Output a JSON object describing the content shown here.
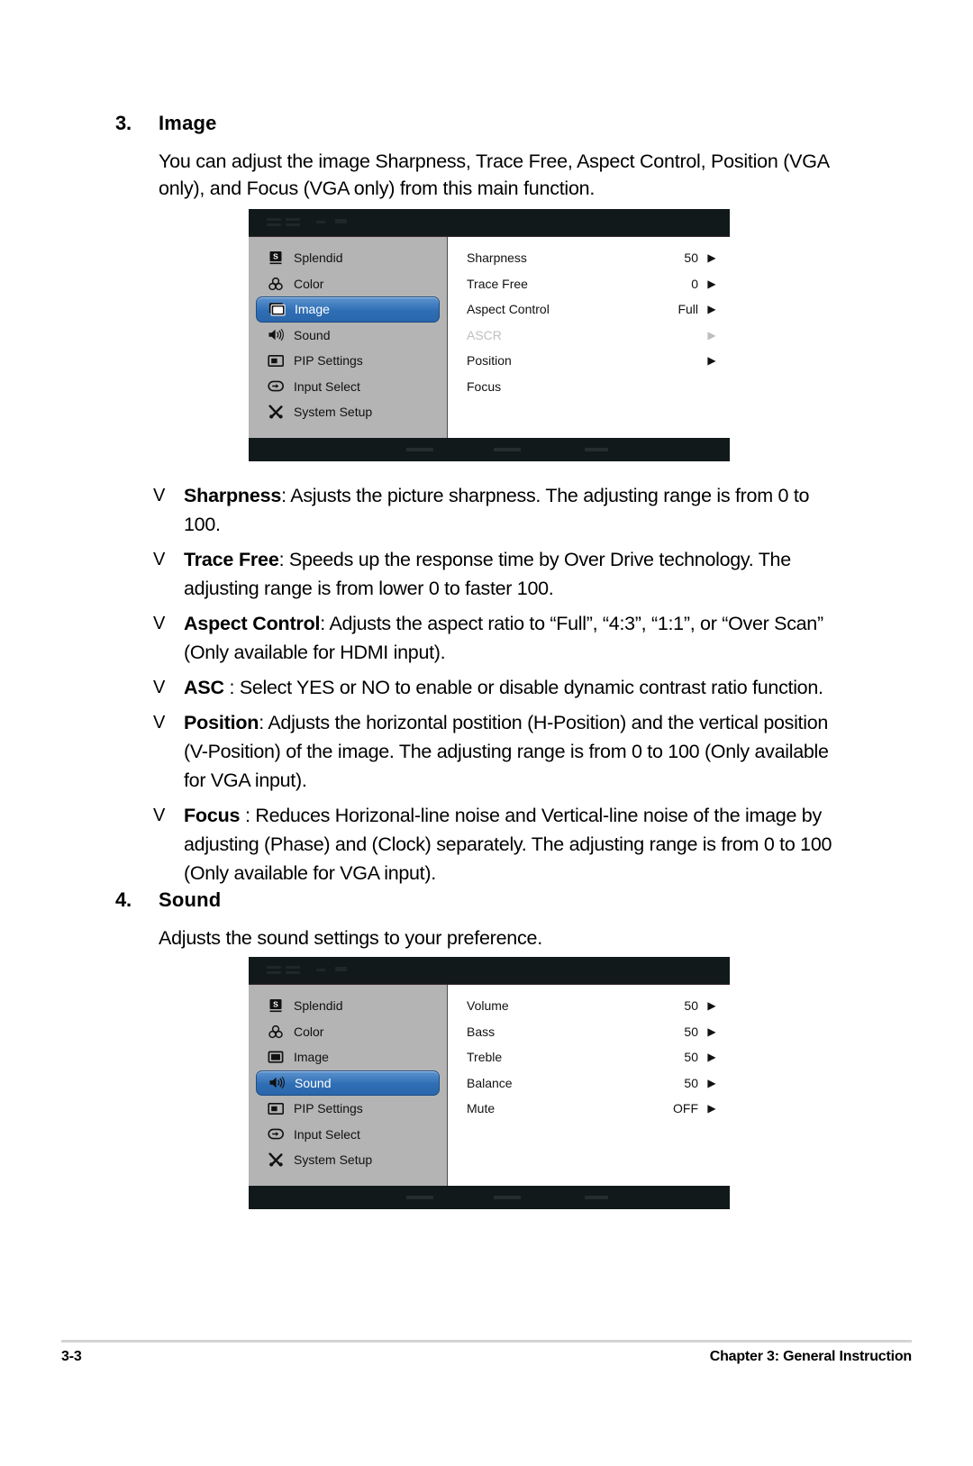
{
  "sections": [
    {
      "number": "3.",
      "title": "Image",
      "intro": "You can adjust the image Sharpness, Trace Free, Aspect Control, Position (VGA only), and Focus (VGA only) from this main function."
    },
    {
      "number": "4.",
      "title": "Sound",
      "intro": "Adjusts the sound settings to your preference."
    }
  ],
  "osd_image": {
    "menu_items": [
      {
        "label": "Splendid",
        "icon": "splendid-icon",
        "selected": false
      },
      {
        "label": "Color",
        "icon": "color-icon",
        "selected": false
      },
      {
        "label": "Image",
        "icon": "image-icon",
        "selected": true
      },
      {
        "label": "Sound",
        "icon": "sound-icon",
        "selected": false
      },
      {
        "label": "PIP Settings",
        "icon": "pip-settings-icon",
        "selected": false
      },
      {
        "label": "Input Select",
        "icon": "input-select-icon",
        "selected": false
      },
      {
        "label": "System Setup",
        "icon": "system-setup-icon",
        "selected": false
      }
    ],
    "options": [
      {
        "label": "Sharpness",
        "value": "50",
        "arrow": "normal",
        "disabled": false
      },
      {
        "label": "Trace Free",
        "value": "0",
        "arrow": "normal",
        "disabled": false
      },
      {
        "label": "Aspect Control",
        "value": "Full",
        "arrow": "normal",
        "disabled": false
      },
      {
        "label": "ASCR",
        "value": "",
        "arrow": "dim",
        "disabled": true
      },
      {
        "label": "Position",
        "value": "",
        "arrow": "normal",
        "disabled": false
      },
      {
        "label": "Focus",
        "value": "",
        "arrow": "none",
        "disabled": false
      }
    ]
  },
  "osd_sound": {
    "menu_items": [
      {
        "label": "Splendid",
        "icon": "splendid-icon",
        "selected": false
      },
      {
        "label": "Color",
        "icon": "color-icon",
        "selected": false
      },
      {
        "label": "Image",
        "icon": "image-icon",
        "selected": false
      },
      {
        "label": "Sound",
        "icon": "sound-icon",
        "selected": true
      },
      {
        "label": "PIP Settings",
        "icon": "pip-settings-icon",
        "selected": false
      },
      {
        "label": "Input Select",
        "icon": "input-select-icon",
        "selected": false
      },
      {
        "label": "System Setup",
        "icon": "system-setup-icon",
        "selected": false
      }
    ],
    "options": [
      {
        "label": "Volume",
        "value": "50",
        "arrow": "normal",
        "disabled": false
      },
      {
        "label": "Bass",
        "value": "50",
        "arrow": "normal",
        "disabled": false
      },
      {
        "label": "Treble",
        "value": "50",
        "arrow": "normal",
        "disabled": false
      },
      {
        "label": "Balance",
        "value": "50",
        "arrow": "normal",
        "disabled": false
      },
      {
        "label": "Mute",
        "value": "OFF",
        "arrow": "normal",
        "disabled": false
      }
    ]
  },
  "bullets": [
    {
      "mark": "V",
      "term": "Sharpness",
      "rest": ": Asjusts the picture sharpness. The adjusting range is from 0 to 100."
    },
    {
      "mark": "V",
      "term": "Trace Free",
      "rest": ": Speeds up the response time by Over Drive technology. The adjusting range is from lower 0 to faster 100."
    },
    {
      "mark": "V",
      "term": "Aspect Control",
      "rest": ": Adjusts the aspect ratio to “Full”, “4:3”, “1:1”, or “Over Scan” (Only available for HDMI input)."
    },
    {
      "mark": "V",
      "term": "ASC",
      "rest": " : Select YES or NO to enable or disable dynamic contrast ratio function."
    },
    {
      "mark": "V",
      "term": "Position",
      "rest": ": Adjusts the horizontal postition (H-Position) and the vertical position (V-Position) of the image. The adjusting range is from 0 to 100 (Only available for VGA input)."
    },
    {
      "mark": "V",
      "term": "Focus",
      "rest": " : Reduces Horizonal-line noise and Vertical-line noise of the image by adjusting (Phase) and (Clock) separately. The adjusting range is from 0 to 100 (Only available for VGA input)."
    }
  ],
  "footer": {
    "page_number": "3-3",
    "chapter": "Chapter 3: General Instruction"
  },
  "colors": {
    "osd_chrome": "#12191b",
    "osd_sidebar": "#b4b4b4",
    "osd_highlight": "#2f6eb5",
    "osd_panel": "#ffffff",
    "disabled_text": "#bfbfbf",
    "footer_rule": "#d4d4d4"
  }
}
